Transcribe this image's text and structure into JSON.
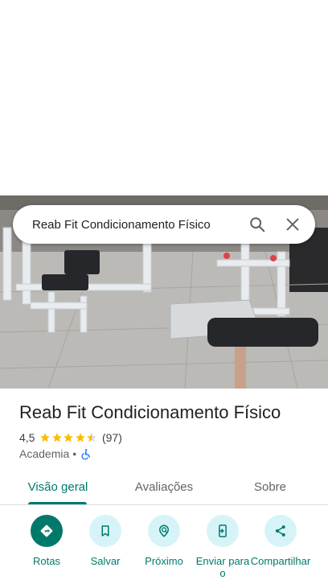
{
  "search": {
    "query": "Reab Fit Condicionamento Físico"
  },
  "place": {
    "name": "Reab Fit Condicionamento Físico",
    "rating": "4,5",
    "rating_value": 4.5,
    "reviews": "(97)",
    "category": "Academia",
    "separator": "•",
    "accessibility_icon": "wheelchair-icon"
  },
  "tabs": [
    {
      "label": "Visão geral",
      "active": true
    },
    {
      "label": "Avaliações",
      "active": false
    },
    {
      "label": "Sobre",
      "active": false
    }
  ],
  "actions": [
    {
      "label": "Rotas",
      "icon": "directions-icon"
    },
    {
      "label": "Salvar",
      "icon": "bookmark-icon"
    },
    {
      "label": "Próximo",
      "icon": "nearby-icon"
    },
    {
      "label": "Enviar para o",
      "icon": "send-to-phone-icon"
    },
    {
      "label": "Compartilhar",
      "icon": "share-icon"
    }
  ],
  "colors": {
    "accent": "#00796b",
    "star": "#fbbc04",
    "action_bg": "#d6f4f8",
    "accessibility": "#1a73e8"
  }
}
